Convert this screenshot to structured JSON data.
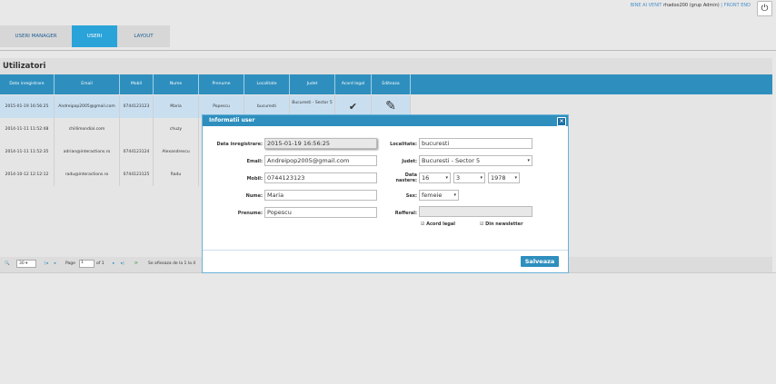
{
  "header": {
    "welcome_prefix": "BINE AI VENIT",
    "user": "rhadoo200 (grup Admin)",
    "separator": "|",
    "front_end": "FRONT END",
    "power_icon": "power-icon"
  },
  "tabs": [
    "USERI MANAGER",
    "USERI",
    "LAYOUT"
  ],
  "grid": {
    "title": "Utilizatori",
    "columns": [
      "Data inregistrare",
      "Email",
      "Mobil",
      "Nume",
      "Prenume",
      "Localitate",
      "Judet",
      "Acord legal",
      "Editeaza"
    ],
    "rows": [
      [
        "2015-01-19 16:56:25",
        "Andreipop2005@gmail.com",
        "0744123123",
        "Maria",
        "Popescu",
        "bucuresti",
        "Bucuresti - Sector 5"
      ],
      [
        "2014-11-11 11:52:48",
        "chillimondial.com",
        "",
        "chuzy",
        "",
        "",
        ""
      ],
      [
        "2014-11-11 11:52:35",
        "adrian@interactions.ro",
        "0744123124",
        "Alexandrescu",
        "",
        "",
        ""
      ],
      [
        "2014-10-12 12:12:12",
        "radu@interactions.ro",
        "0744123125",
        "Radu",
        "",
        "",
        ""
      ]
    ],
    "pager": {
      "page_size": "30",
      "page_label": "Page",
      "page_value": "1",
      "of_label": "of 1",
      "info": "Se afiseaza de la 1 la 4"
    }
  },
  "modal": {
    "title": "Informatii user",
    "close": "×",
    "fields": {
      "data_inregistrare": {
        "label": "Data inregistrare:",
        "value": "2015-01-19 16:56:25"
      },
      "email": {
        "label": "Email:",
        "value": "Andreipop2005@gmail.com"
      },
      "mobil": {
        "label": "Mobil:",
        "value": "0744123123"
      },
      "nume": {
        "label": "Nume:",
        "value": "Maria"
      },
      "prenume": {
        "label": "Prenume:",
        "value": "Popescu"
      },
      "localitate": {
        "label": "Localitate:",
        "value": "bucuresti"
      },
      "judet": {
        "label": "Judet:",
        "value": "Bucuresti - Sector 5"
      },
      "data_nastere": {
        "label_1": "Data",
        "label_2": "nastere:",
        "zi": "16",
        "luna": "3",
        "an": "1978"
      },
      "sex": {
        "label": "Sex:",
        "value": "femeie"
      },
      "referal": {
        "label": "Refferal:",
        "value": ""
      },
      "acord_legal": "Acord legal",
      "newsletter": "Din newsletter"
    },
    "save": "Salveaza"
  }
}
